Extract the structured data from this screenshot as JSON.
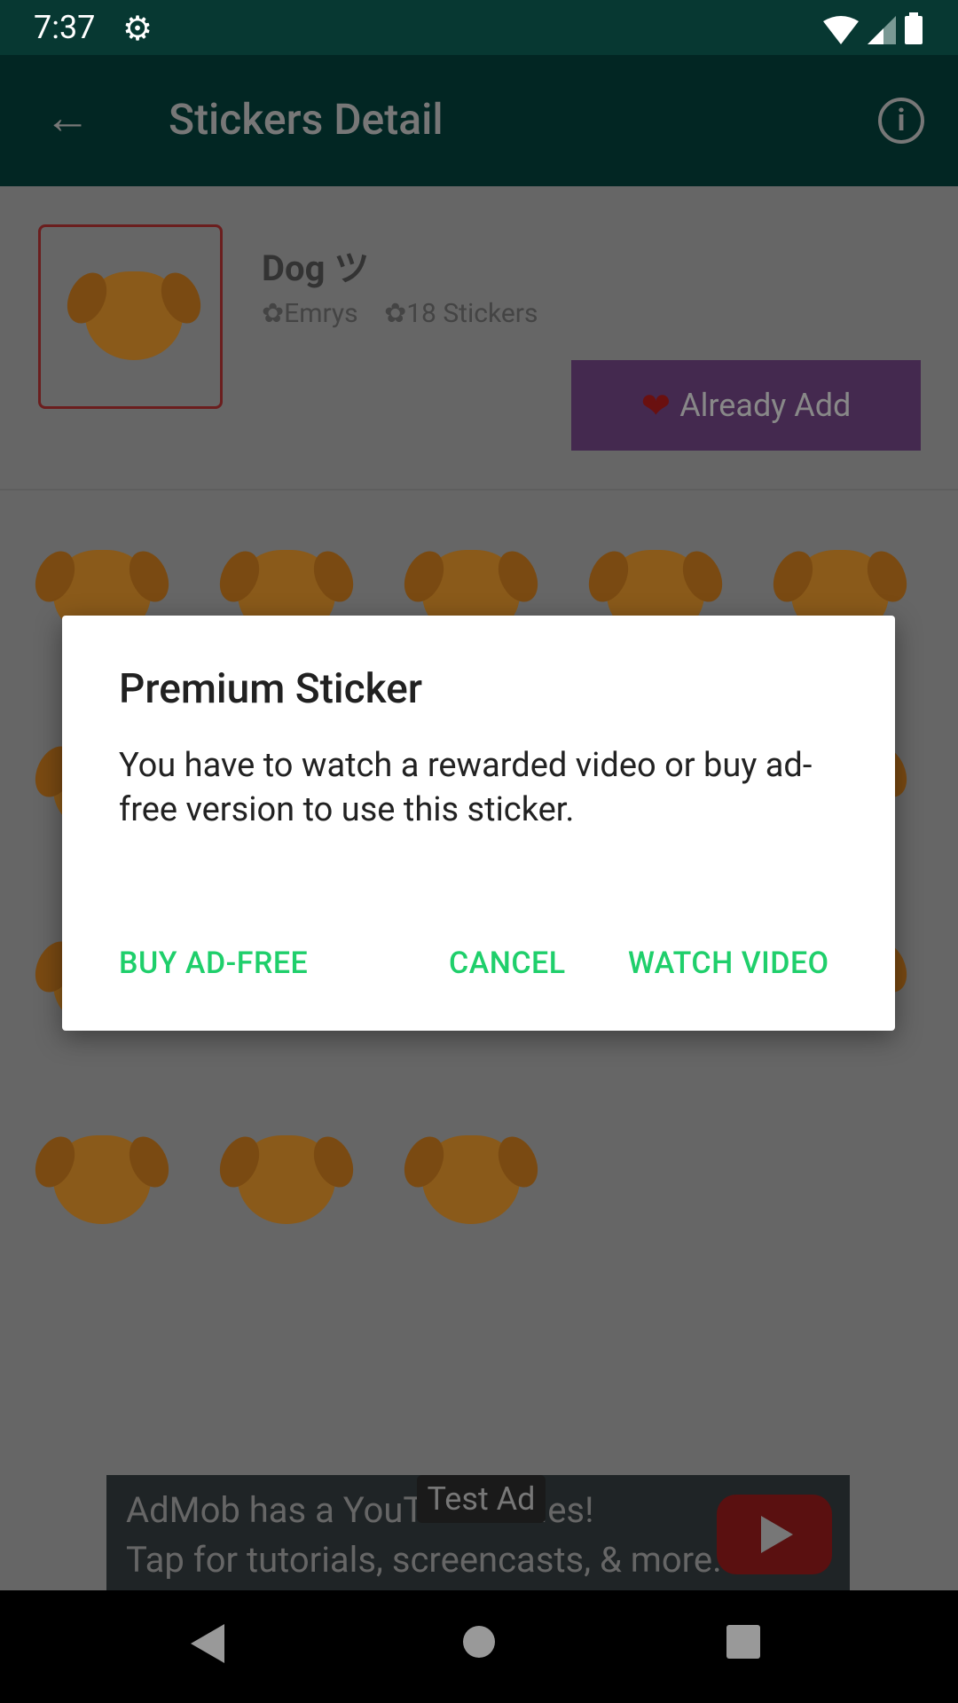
{
  "status_bar": {
    "time": "7:37",
    "icons": [
      "gear-icon",
      "wifi-icon",
      "signal-icon",
      "battery-icon"
    ]
  },
  "toolbar": {
    "title": "Stickers Detail",
    "back_icon": "arrow-back-icon",
    "info_icon": "info-icon",
    "info_glyph": "i"
  },
  "pack": {
    "name": "Dog ツ",
    "author": "✿Emrys",
    "count": "✿18 Stickers",
    "add_button": "Already Add",
    "add_icon": "❤"
  },
  "stickers_count": 18,
  "dialog": {
    "title": "Premium Sticker",
    "message": "You have to watch a rewarded video or buy ad-free version to use this sticker.",
    "buttons": {
      "buy": "BUY AD-FREE",
      "cancel": "CANCEL",
      "watch": "WATCH VIDEO"
    }
  },
  "ad": {
    "label": "Test Ad",
    "line1": "AdMob has a YouTube series!",
    "line2": "Tap for tutorials, screencasts, & more."
  },
  "colors": {
    "accent": "#1fcf6b",
    "toolbar": "#022623",
    "button": "#44294f"
  }
}
